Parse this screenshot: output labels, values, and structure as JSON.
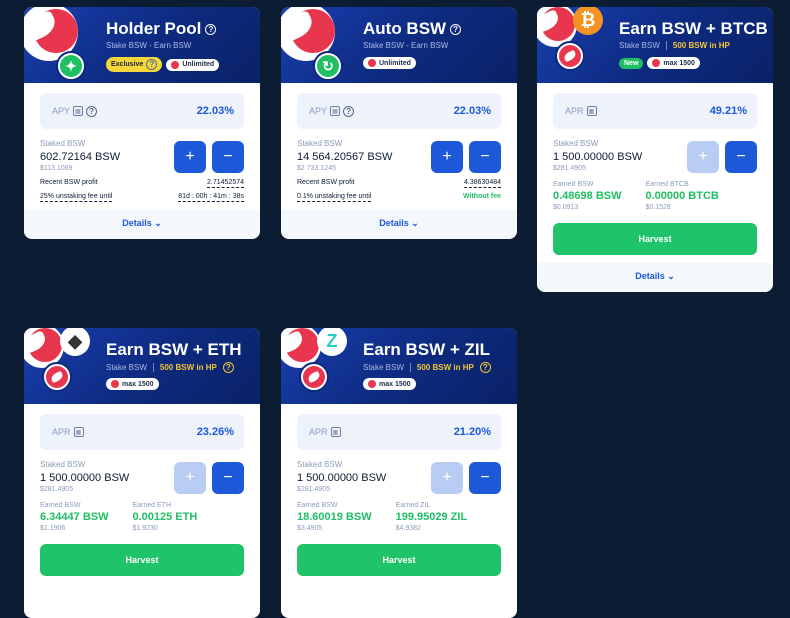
{
  "cards": [
    {
      "title": "Holder Pool",
      "subtitle": "Stake BSW - Earn BSW",
      "badges": [
        "Exclusive",
        "Unlimited"
      ],
      "apy_label": "APY",
      "apy_value": "22.03%",
      "staked_label": "Staked BSW",
      "staked_value": "602.72164 BSW",
      "staked_usd": "$113.1069",
      "profit_label": "Recent BSW profit",
      "profit_value": "2.71452574",
      "fee_label": "25% unstaking fee until",
      "fee_value": "81d : 00h : 41m : 38s",
      "details_label": "Details",
      "plus": "+",
      "minus": "−"
    },
    {
      "title": "Auto BSW",
      "subtitle": "Stake BSW - Earn BSW",
      "badges": [
        "Unlimited"
      ],
      "apy_label": "APY",
      "apy_value": "22.03%",
      "staked_label": "Staked BSW",
      "staked_value": "14 564.20567 BSW",
      "staked_usd": "$2 733.1245",
      "profit_label": "Recent BSW profit",
      "profit_value": "4.38630484",
      "fee_label": "0.1% unstaking fee until",
      "fee_value": "Without fee",
      "details_label": "Details",
      "plus": "+",
      "minus": "−"
    },
    {
      "title": "Earn BSW + BTCB",
      "subtitle": "Stake BSW",
      "hp_req": "500 BSW in HP",
      "badges": [
        "New",
        "max 1500"
      ],
      "apy_label": "APR",
      "apy_value": "49.21%",
      "staked_label": "Staked BSW",
      "staked_value": "1 500.00000 BSW",
      "staked_usd": "$281.4905",
      "earned": [
        {
          "label": "Earned BSW",
          "value": "0.48698 BSW",
          "usd": "$0.0913"
        },
        {
          "label": "Earned BTCB",
          "value": "0.00000 BTCB",
          "usd": "$0.1528"
        }
      ],
      "harvest_label": "Harvest",
      "details_label": "Details",
      "plus": "+",
      "minus": "−",
      "token_symbol": "₿"
    },
    {
      "title": "Earn BSW + ETH",
      "subtitle": "Stake BSW",
      "hp_req": "500 BSW in HP",
      "badges": [
        "max 1500"
      ],
      "apy_label": "APR",
      "apy_value": "23.26%",
      "staked_label": "Staked BSW",
      "staked_value": "1 500.00000 BSW",
      "staked_usd": "$281.4905",
      "earned": [
        {
          "label": "Earned BSW",
          "value": "6.34447 BSW",
          "usd": "$1.1906"
        },
        {
          "label": "Earned ETH",
          "value": "0.00125 ETH",
          "usd": "$1.9230"
        }
      ],
      "harvest_label": "Harvest",
      "plus": "+",
      "minus": "−",
      "token_symbol": "◆"
    },
    {
      "title": "Earn BSW + ZIL",
      "subtitle": "Stake BSW",
      "hp_req": "500 BSW in HP",
      "badges": [
        "max 1500"
      ],
      "apy_label": "APR",
      "apy_value": "21.20%",
      "staked_label": "Staked BSW",
      "staked_value": "1 500.00000 BSW",
      "staked_usd": "$281.4905",
      "earned": [
        {
          "label": "Earned BSW",
          "value": "18.60019 BSW",
          "usd": "$3.4905"
        },
        {
          "label": "Earned ZIL",
          "value": "199.95029 ZIL",
          "usd": "$4.9382"
        }
      ],
      "harvest_label": "Harvest",
      "plus": "+",
      "minus": "−",
      "token_symbol": "Z"
    }
  ],
  "colors": {
    "background": "#0b1c33",
    "accent_blue": "#1c58d8",
    "green": "#1fc46a",
    "yellow": "#f5c537",
    "brand_red": "#e8364f"
  },
  "icons": [
    "question-icon",
    "calculator-icon",
    "chevron-down-icon",
    "refresh-icon",
    "bird-logo-icon",
    "bitcoin-icon",
    "ethereum-icon",
    "zilliqa-icon"
  ]
}
